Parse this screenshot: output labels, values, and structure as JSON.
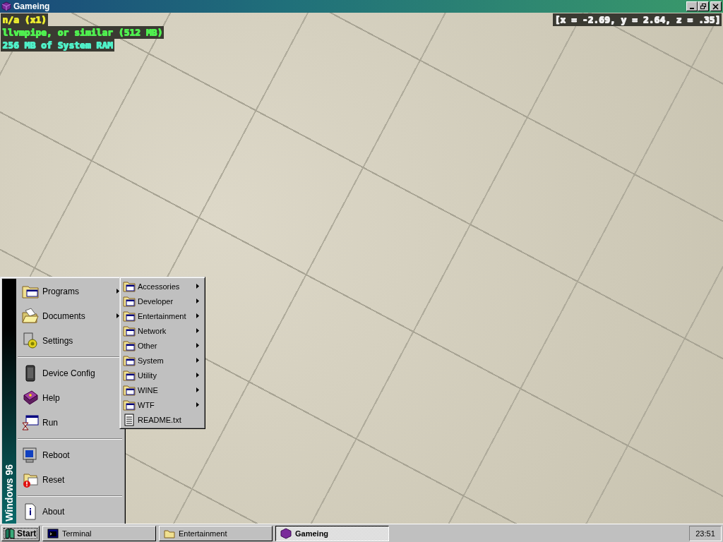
{
  "window": {
    "title": "Gameing"
  },
  "overlay": {
    "lines": [
      {
        "text": "n/a (x1)"
      },
      {
        "text": "llvmpipe, or similar (512 MB)"
      },
      {
        "text": "256 MB of System RAM"
      }
    ],
    "coordinates": "[x = -2.69, y = 2.64, z = .35]"
  },
  "start_menu": {
    "banner": "Windows 96",
    "groups": [
      {
        "items": [
          {
            "label": "Programs",
            "has_submenu": true
          },
          {
            "label": "Documents",
            "has_submenu": true
          },
          {
            "label": "Settings",
            "has_submenu": false
          }
        ]
      },
      {
        "items": [
          {
            "label": "Device Config",
            "has_submenu": false
          },
          {
            "label": "Help",
            "has_submenu": false
          },
          {
            "label": "Run",
            "has_submenu": false
          }
        ]
      },
      {
        "items": [
          {
            "label": "Reboot",
            "has_submenu": false
          },
          {
            "label": "Reset",
            "has_submenu": false
          }
        ]
      },
      {
        "items": [
          {
            "label": "About",
            "has_submenu": false
          }
        ]
      }
    ]
  },
  "submenu": {
    "items": [
      {
        "label": "Accessories",
        "has_submenu": true
      },
      {
        "label": "Developer",
        "has_submenu": true
      },
      {
        "label": "Entertainment",
        "has_submenu": true
      },
      {
        "label": "Network",
        "has_submenu": true
      },
      {
        "label": "Other",
        "has_submenu": true
      },
      {
        "label": "System",
        "has_submenu": true
      },
      {
        "label": "Utility",
        "has_submenu": true
      },
      {
        "label": "WINE",
        "has_submenu": true
      },
      {
        "label": "WTF",
        "has_submenu": true
      },
      {
        "label": "README.txt",
        "has_submenu": false
      }
    ]
  },
  "taskbar": {
    "start": "Start",
    "tasks": [
      {
        "label": "Terminal",
        "selected": false
      },
      {
        "label": "Entertainment",
        "selected": false
      },
      {
        "label": "Gameing",
        "selected": true
      }
    ],
    "clock": "23:51"
  }
}
